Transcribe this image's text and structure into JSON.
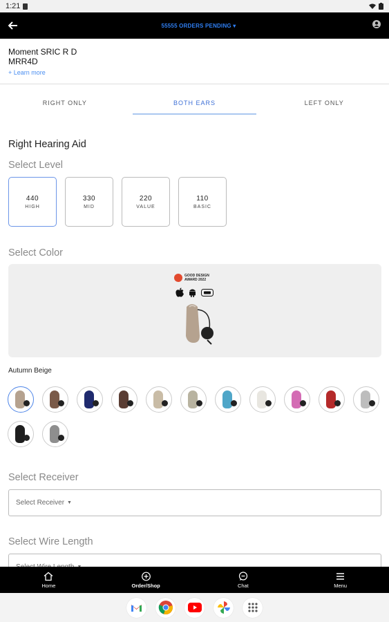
{
  "status": {
    "time": "1:21"
  },
  "header": {
    "orders_label": "55555 ORDERS PENDING ▾"
  },
  "product": {
    "name": "Moment SRIC R D",
    "code": "MRR4D",
    "learn_more": "+ Learn more"
  },
  "tabs": [
    {
      "label": "RIGHT ONLY",
      "active": false
    },
    {
      "label": "BOTH EARS",
      "active": true
    },
    {
      "label": "LEFT ONLY",
      "active": false
    }
  ],
  "section_title": "Right Hearing Aid",
  "select_level": {
    "title": "Select Level",
    "options": [
      {
        "value": "440",
        "label": "HIGH",
        "selected": true
      },
      {
        "value": "330",
        "label": "MID",
        "selected": false
      },
      {
        "value": "220",
        "label": "VALUE",
        "selected": false
      },
      {
        "value": "110",
        "label": "BASIC",
        "selected": false
      }
    ]
  },
  "select_color": {
    "title": "Select Color",
    "award_line1": "GOOD DESIGN",
    "award_line2": "AWARD 2022",
    "selected_name": "Autumn Beige",
    "swatches": [
      "#b5a28f",
      "#7a5a48",
      "#1f2a6e",
      "#5a3d33",
      "#c9bca6",
      "#b8b3a0",
      "#4fa6c8",
      "#e8e6e0",
      "#d46cb4",
      "#b52a2a",
      "#bdbdbd",
      "#1e1e1e",
      "#8e8e8e"
    ]
  },
  "select_receiver": {
    "title": "Select Receiver",
    "placeholder": "Select Receiver"
  },
  "select_wire": {
    "title": "Select Wire Length",
    "placeholder": "Select Wire Length"
  },
  "bottom_nav": [
    {
      "label": "Home",
      "icon": "home-icon",
      "active": false
    },
    {
      "label": "Order/Shop",
      "icon": "plus-circle-icon",
      "active": true
    },
    {
      "label": "Chat",
      "icon": "chat-icon",
      "active": false
    },
    {
      "label": "Menu",
      "icon": "menu-icon",
      "active": false
    }
  ],
  "dock_apps": [
    "gmail-icon",
    "chrome-icon",
    "youtube-icon",
    "photos-icon",
    "apps-icon"
  ]
}
